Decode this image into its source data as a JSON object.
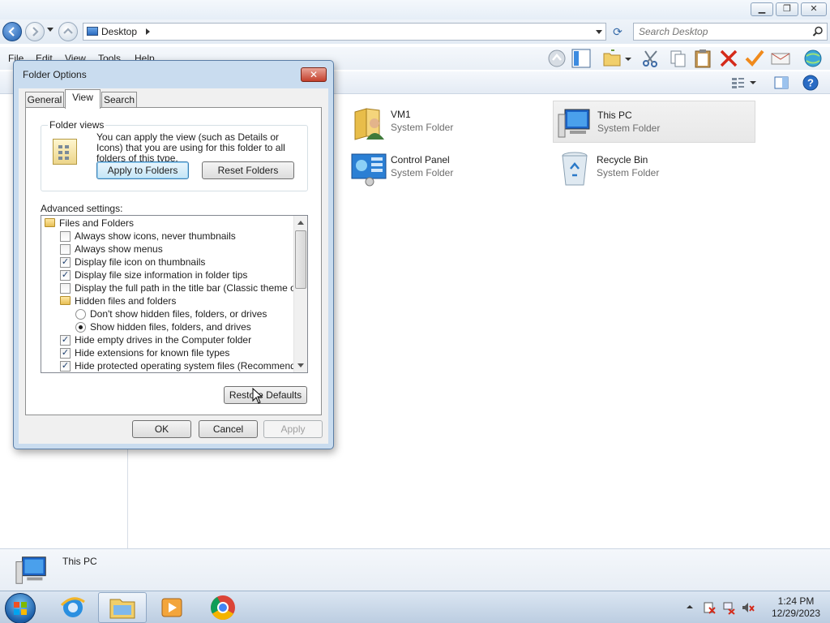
{
  "explorer": {
    "window_buttons": {
      "minimize": "▁",
      "maximize": "❐",
      "close": "✕"
    },
    "address": {
      "location": "Desktop"
    },
    "search": {
      "placeholder": "Search Desktop"
    },
    "menu": [
      "File",
      "Edit",
      "View",
      "Tools",
      "Help"
    ],
    "toolbar_icons": [
      "up-icon",
      "pane-icon",
      "folder-icon",
      "cut-icon",
      "copy-icon",
      "paste-icon",
      "delete-icon",
      "check-icon",
      "email-icon",
      "globe-icon"
    ],
    "items": [
      {
        "name": "VM1",
        "type": "System Folder",
        "icon": "user-folder-icon",
        "selected": false
      },
      {
        "name": "This PC",
        "type": "System Folder",
        "icon": "computer-icon",
        "selected": true
      },
      {
        "name": "Control Panel",
        "type": "System Folder",
        "icon": "control-panel-icon",
        "selected": false
      },
      {
        "name": "Recycle Bin",
        "type": "System Folder",
        "icon": "recycle-bin-icon",
        "selected": false
      }
    ],
    "details": {
      "name": "This PC"
    }
  },
  "dialog": {
    "title": "Folder Options",
    "close": "✕",
    "tabs": [
      "General",
      "View",
      "Search"
    ],
    "active_tab": "View",
    "folder_views": {
      "legend": "Folder views",
      "description": "You can apply the view (such as Details or Icons) that you are using for this folder to all folders of this type.",
      "apply_button": "Apply to Folders",
      "reset_button": "Reset Folders"
    },
    "advanced_label": "Advanced settings:",
    "advanced": [
      {
        "kind": "folder",
        "label": "Files and Folders",
        "indent": 0
      },
      {
        "kind": "checkbox",
        "label": "Always show icons, never thumbnails",
        "checked": false,
        "indent": 1
      },
      {
        "kind": "checkbox",
        "label": "Always show menus",
        "checked": false,
        "indent": 1
      },
      {
        "kind": "checkbox",
        "label": "Display file icon on thumbnails",
        "checked": true,
        "indent": 1
      },
      {
        "kind": "checkbox",
        "label": "Display file size information in folder tips",
        "checked": true,
        "indent": 1
      },
      {
        "kind": "checkbox",
        "label": "Display the full path in the title bar (Classic theme only)",
        "checked": false,
        "indent": 1
      },
      {
        "kind": "folder",
        "label": "Hidden files and folders",
        "indent": 1
      },
      {
        "kind": "radio",
        "label": "Don't show hidden files, folders, or drives",
        "checked": false,
        "indent": 2
      },
      {
        "kind": "radio",
        "label": "Show hidden files, folders, and drives",
        "checked": true,
        "indent": 2
      },
      {
        "kind": "checkbox",
        "label": "Hide empty drives in the Computer folder",
        "checked": true,
        "indent": 1
      },
      {
        "kind": "checkbox",
        "label": "Hide extensions for known file types",
        "checked": true,
        "indent": 1
      },
      {
        "kind": "checkbox",
        "label": "Hide protected operating system files (Recommended)",
        "checked": true,
        "indent": 1
      }
    ],
    "restore_button": "Restore Defaults",
    "ok": "OK",
    "cancel": "Cancel",
    "apply": "Apply"
  },
  "taskbar": {
    "apps": [
      "internet-explorer-icon",
      "file-explorer-icon",
      "media-player-icon",
      "chrome-icon"
    ],
    "clock": {
      "time": "1:24 PM",
      "date": "12/29/2023"
    }
  }
}
